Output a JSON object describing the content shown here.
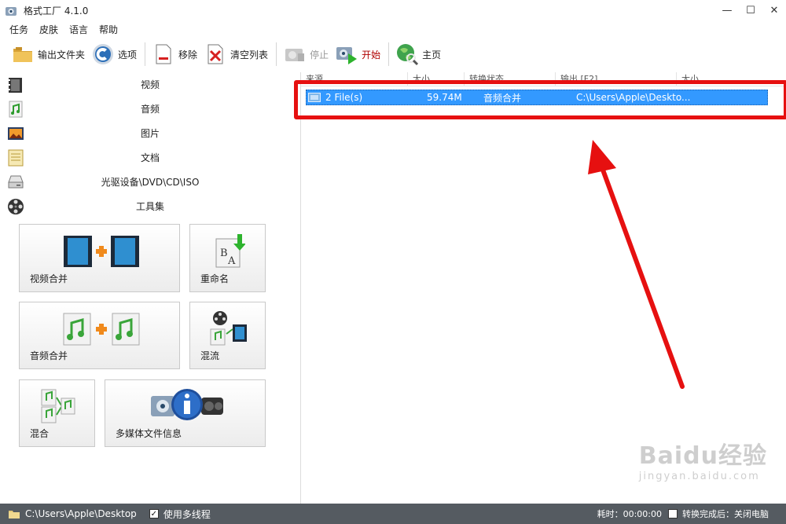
{
  "window": {
    "title": "格式工厂 4.1.0",
    "minimize": "—",
    "maximize": "☐",
    "close": "✕"
  },
  "menu": [
    "任务",
    "皮肤",
    "语言",
    "帮助"
  ],
  "toolbar": {
    "output_folder": "输出文件夹",
    "options": "选项",
    "remove": "移除",
    "clear_list": "清空列表",
    "stop": "停止",
    "start": "开始",
    "home": "主页"
  },
  "categories": [
    "视频",
    "音频",
    "图片",
    "文档",
    "光驱设备\\DVD\\CD\\ISO",
    "工具集"
  ],
  "tools": {
    "video_merge": "视频合并",
    "rename": "重命名",
    "audio_merge": "音频合并",
    "mux": "混流",
    "mix": "混合",
    "media_info": "多媒体文件信息"
  },
  "list": {
    "headers": [
      "来源",
      "大小",
      "转换状态",
      "输出 [F2]",
      "大小"
    ],
    "row": {
      "source": "2 File(s)",
      "size": "59.74M",
      "status": "音频合并",
      "output": "C:\\Users\\Apple\\Deskto..."
    }
  },
  "status": {
    "path": "C:\\Users\\Apple\\Desktop",
    "multithread_label": "使用多线程",
    "multithread_checked": "✓",
    "elapsed": "耗时：00:00:00",
    "after_done": "转换完成后：关闭电脑"
  },
  "watermark": {
    "brand": "Baidu经验",
    "url": "jingyan.baidu.com"
  },
  "colors": {
    "selection": "#3399ff",
    "highlight": "#e61010",
    "statusbar": "#555b61"
  }
}
